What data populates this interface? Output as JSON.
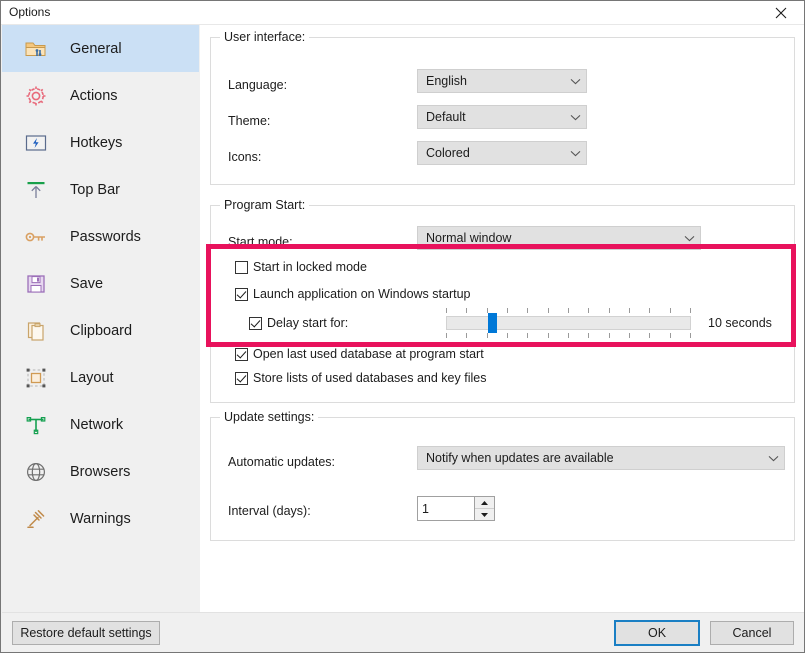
{
  "window": {
    "title": "Options",
    "close_icon": "close-icon"
  },
  "sidebar": {
    "items": [
      {
        "label": "General",
        "icon": "folder-settings-icon",
        "selected": true
      },
      {
        "label": "Actions",
        "icon": "gear-icon",
        "selected": false
      },
      {
        "label": "Hotkeys",
        "icon": "keyboard-bolt-icon",
        "selected": false
      },
      {
        "label": "Top Bar",
        "icon": "arrow-up-bar-icon",
        "selected": false
      },
      {
        "label": "Passwords",
        "icon": "key-icon",
        "selected": false
      },
      {
        "label": "Save",
        "icon": "floppy-disk-icon",
        "selected": false
      },
      {
        "label": "Clipboard",
        "icon": "clipboard-icon",
        "selected": false
      },
      {
        "label": "Layout",
        "icon": "layout-icon",
        "selected": false
      },
      {
        "label": "Network",
        "icon": "network-icon",
        "selected": false
      },
      {
        "label": "Browsers",
        "icon": "globe-icon",
        "selected": false
      },
      {
        "label": "Warnings",
        "icon": "gavel-icon",
        "selected": false
      }
    ]
  },
  "user_interface": {
    "group_title": "User interface:",
    "language_label": "Language:",
    "language_value": "English",
    "theme_label": "Theme:",
    "theme_value": "Default",
    "icons_label": "Icons:",
    "icons_value": "Colored"
  },
  "program_start": {
    "group_title": "Program Start:",
    "start_mode_label": "Start mode:",
    "start_mode_value": "Normal window",
    "start_locked_label": "Start in locked mode",
    "start_locked_checked": false,
    "launch_startup_label": "Launch application on Windows startup",
    "launch_startup_checked": true,
    "delay_label": "Delay start for:",
    "delay_checked": true,
    "delay_value_text": "10 seconds",
    "delay_ticks": 13,
    "delay_thumb_percent": 18,
    "open_last_db_label": "Open last used database at program start",
    "open_last_db_checked": true,
    "store_lists_label": "Store lists of used databases and key files",
    "store_lists_checked": true
  },
  "update_settings": {
    "group_title": "Update settings:",
    "automatic_updates_label": "Automatic updates:",
    "automatic_updates_value": "Notify when updates are available",
    "interval_label": "Interval (days):",
    "interval_value": "1"
  },
  "footer": {
    "restore_label": "Restore default settings",
    "ok_label": "OK",
    "cancel_label": "Cancel"
  },
  "highlight": {
    "color": "#e8125c"
  }
}
